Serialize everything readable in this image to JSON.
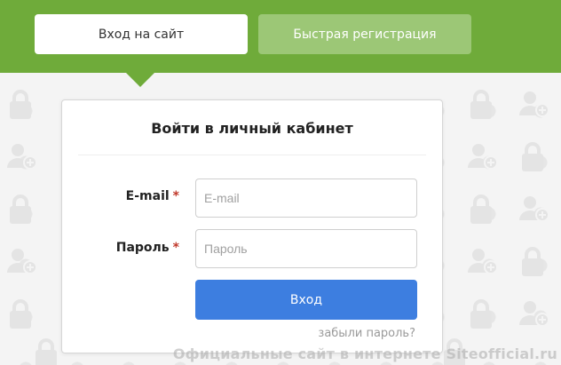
{
  "tabs": {
    "login_label": "Вход на сайт",
    "register_label": "Быстрая регистрация"
  },
  "form": {
    "title": "Войти в личный кабинет",
    "email_label": "E-mail",
    "email_placeholder": "E-mail",
    "password_label": "Пароль",
    "password_placeholder": "Пароль",
    "required_mark": "*",
    "submit_label": "Вход",
    "forgot_label": "забыли пароль?"
  },
  "watermark": "Официальные сайт в интернете Siteofficial.ru",
  "background_icons": [
    "lock-icon",
    "user-add-icon"
  ],
  "colors": {
    "brand_green": "#6fab3a",
    "inactive_tab": "#9cc776",
    "primary_button": "#3d7ee0",
    "required": "#c0392b"
  }
}
